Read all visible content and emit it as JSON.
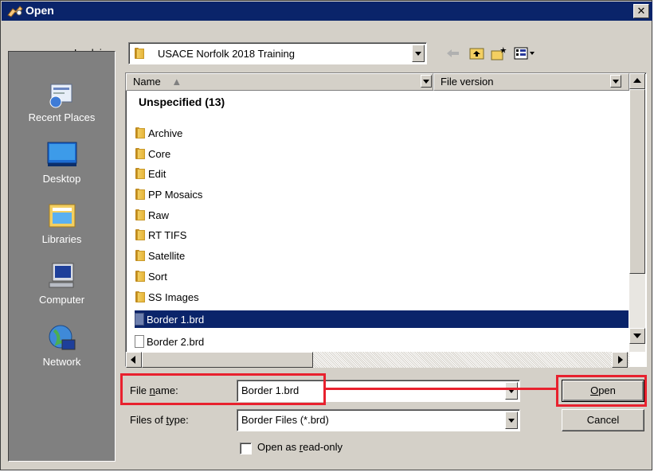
{
  "window": {
    "title": "Open",
    "close_symbol": "✕"
  },
  "look_in": {
    "label_pre": "Look ",
    "label_accel": "i",
    "label_post": "n:",
    "value": "USACE Norfolk 2018 Training"
  },
  "toolbar": {
    "back_icon": "back-arrow-icon",
    "up_icon": "up-folder-icon",
    "new_folder_icon": "new-folder-icon",
    "view_icon": "view-menu-icon"
  },
  "places": [
    {
      "label": "Recent Places",
      "icon": "recent-places-icon"
    },
    {
      "label": "Desktop",
      "icon": "desktop-icon"
    },
    {
      "label": "Libraries",
      "icon": "libraries-icon"
    },
    {
      "label": "Computer",
      "icon": "computer-icon"
    },
    {
      "label": "Network",
      "icon": "network-icon"
    }
  ],
  "list": {
    "columns": [
      "Name",
      "File version"
    ],
    "group_header": "Unspecified (13)",
    "items": [
      {
        "name": "Archive",
        "type": "folder"
      },
      {
        "name": "Core",
        "type": "folder"
      },
      {
        "name": "Edit",
        "type": "folder"
      },
      {
        "name": "PP Mosaics",
        "type": "folder"
      },
      {
        "name": "Raw",
        "type": "folder"
      },
      {
        "name": "RT TIFS",
        "type": "folder"
      },
      {
        "name": "Satellite",
        "type": "folder"
      },
      {
        "name": "Sort",
        "type": "folder"
      },
      {
        "name": "SS Images",
        "type": "folder"
      },
      {
        "name": "Border 1.brd",
        "type": "file",
        "selected": true
      },
      {
        "name": "Border 2.brd",
        "type": "file"
      }
    ]
  },
  "file_name": {
    "label_pre": "File ",
    "label_accel": "n",
    "label_post": "ame:",
    "value": "Border 1.brd"
  },
  "file_type": {
    "label_pre": "Files of ",
    "label_accel": "t",
    "label_post": "ype:",
    "value": "Border Files (*.brd)"
  },
  "read_only": {
    "label_pre": "Open as ",
    "label_accel": "r",
    "label_post": "ead-only",
    "checked": false
  },
  "buttons": {
    "open_accel": "O",
    "open_rest": "pen",
    "cancel": "Cancel"
  },
  "colors": {
    "title_bar": "#0a246a",
    "selection": "#0a246a",
    "highlight_annotation": "#e8212e"
  }
}
